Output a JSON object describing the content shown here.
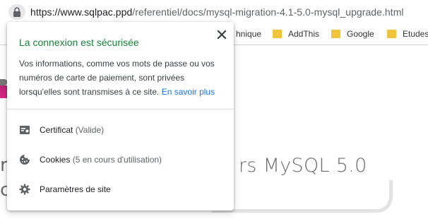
{
  "address_bar": {
    "url_domain": "https://www.sqlpac.ppd",
    "url_path": "/referentiel/docs/mysql-migration-4.1-5.0-mysql_upgrade.html"
  },
  "bookmarks": [
    {
      "label": "hnique"
    },
    {
      "label": "AddThis"
    },
    {
      "label": "Google"
    },
    {
      "label": "Etudes"
    }
  ],
  "page": {
    "title_fragment": "rs MySQL 5.0",
    "left_letter_1": "r",
    "left_letter_2": "c"
  },
  "popup": {
    "title": "La connexion est sécurisée",
    "description": "Vos informations, comme vos mots de passe ou vos numéros de carte de paiement, sont privées lorsqu'elles sont transmises à ce site.",
    "learn_more": "En savoir plus",
    "certificate_label": "Certificat",
    "certificate_status": "(Valide)",
    "cookies_label": "Cookies",
    "cookies_status": "(5 en cours d'utilisation)",
    "site_settings_label": "Paramètres de site"
  },
  "colors": {
    "secure_green": "#188038",
    "link_blue": "#1a73e8",
    "folder_yellow": "#f0c33c"
  }
}
